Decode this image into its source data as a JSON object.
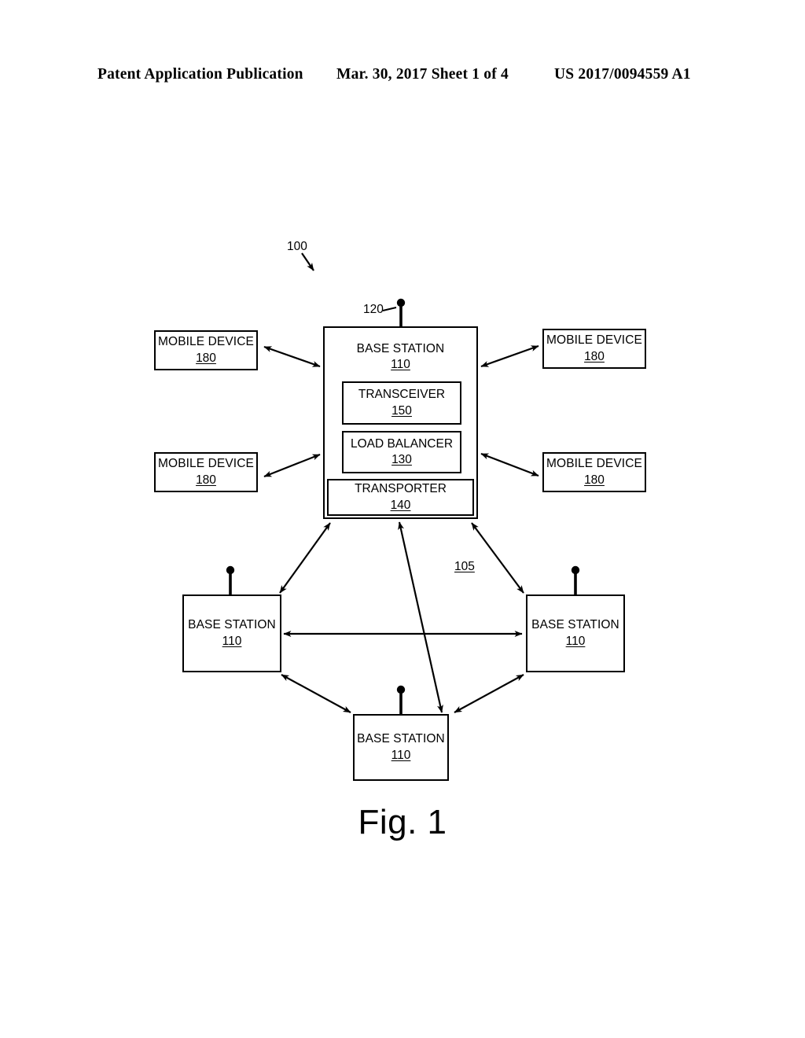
{
  "header": {
    "publication": "Patent Application Publication",
    "date_sheet": "Mar. 30, 2017  Sheet 1 of 4",
    "patent_number": "US 2017/0094559 A1"
  },
  "figure": {
    "caption": "Fig. 1",
    "system_ref": "100",
    "antenna_ref": "120",
    "network_ref": "105"
  },
  "central_base_station": {
    "label": "BASE STATION",
    "ref": "110",
    "modules": [
      {
        "label": "TRANSCEIVER",
        "ref": "150"
      },
      {
        "label": "LOAD BALANCER",
        "ref": "130"
      },
      {
        "label": "TRANSPORTER",
        "ref": "140"
      }
    ]
  },
  "mobile_devices": [
    {
      "label": "MOBILE DEVICE",
      "ref": "180",
      "position": "top-left"
    },
    {
      "label": "MOBILE DEVICE",
      "ref": "180",
      "position": "bottom-left"
    },
    {
      "label": "MOBILE DEVICE",
      "ref": "180",
      "position": "top-right"
    },
    {
      "label": "MOBILE DEVICE",
      "ref": "180",
      "position": "bottom-right"
    }
  ],
  "peripheral_base_stations": [
    {
      "label": "BASE STATION",
      "ref": "110",
      "position": "left"
    },
    {
      "label": "BASE STATION",
      "ref": "110",
      "position": "right"
    },
    {
      "label": "BASE STATION",
      "ref": "110",
      "position": "bottom"
    }
  ]
}
